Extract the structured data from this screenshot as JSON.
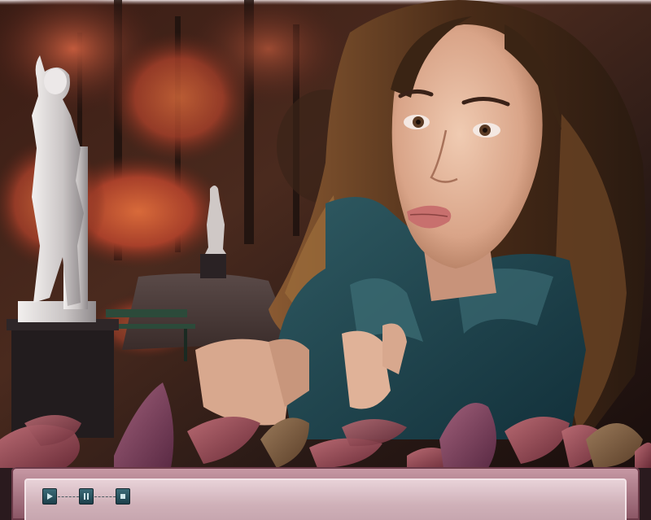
{
  "scene": {
    "subject": "woman-in-teal-coat",
    "background": "autumn-park-with-statues",
    "foreground": "autumn-leaves-border"
  },
  "player": {
    "controls": [
      {
        "name": "play-button",
        "icon": "play-icon"
      },
      {
        "name": "pause-button",
        "icon": "pause-icon"
      },
      {
        "name": "stop-button",
        "icon": "stop-icon"
      }
    ]
  },
  "colors": {
    "frame": "#8a5564",
    "panel": "#d9bcc3",
    "buttons": "#2a5561"
  }
}
